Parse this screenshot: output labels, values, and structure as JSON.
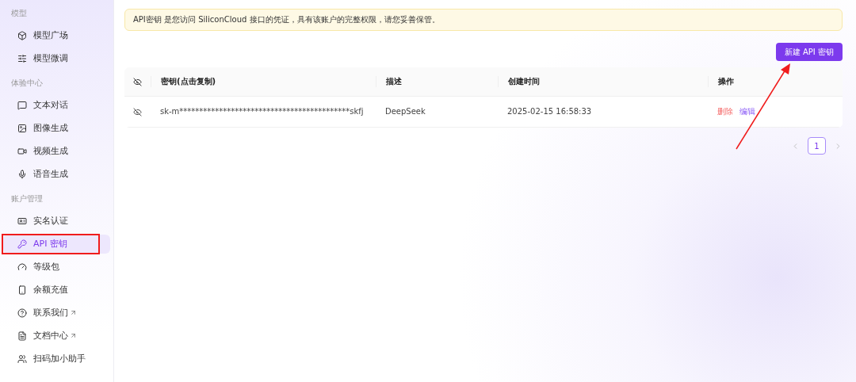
{
  "sidebar": {
    "groups": [
      {
        "heading": "模型",
        "items": [
          {
            "label": "模型广场",
            "selected": false,
            "external": false
          },
          {
            "label": "模型微调",
            "selected": false,
            "external": false
          }
        ]
      },
      {
        "heading": "体验中心",
        "items": [
          {
            "label": "文本对话",
            "selected": false,
            "external": false
          },
          {
            "label": "图像生成",
            "selected": false,
            "external": false
          },
          {
            "label": "视频生成",
            "selected": false,
            "external": false
          },
          {
            "label": "语音生成",
            "selected": false,
            "external": false
          }
        ]
      },
      {
        "heading": "账户管理",
        "items": [
          {
            "label": "实名认证",
            "selected": false,
            "external": false
          },
          {
            "label": "API 密钥",
            "selected": true,
            "external": false,
            "highlighted": true
          },
          {
            "label": "等级包",
            "selected": false,
            "external": false
          },
          {
            "label": "余额充值",
            "selected": false,
            "external": false
          },
          {
            "label": "联系我们",
            "selected": false,
            "external": true
          },
          {
            "label": "文档中心",
            "selected": false,
            "external": true
          },
          {
            "label": "扫码加小助手",
            "selected": false,
            "external": false
          }
        ]
      }
    ]
  },
  "notice": "API密钥 是您访问 SiliconCloud 接口的凭证，具有该账户的完整权限，请您妥善保管。",
  "create_button": "新建 API 密钥",
  "table": {
    "columns": [
      "密钥(点击复制)",
      "描述",
      "创建时间",
      "操作"
    ],
    "rows": [
      {
        "key": "sk-m*******************************************skfj",
        "description": "DeepSeek",
        "created": "2025-02-15 16:58:33",
        "actions": [
          {
            "label": "删除",
            "kind": "danger"
          },
          {
            "label": "编辑",
            "kind": "primary"
          }
        ]
      }
    ]
  },
  "pagination": {
    "pages": [
      {
        "label": "1",
        "selected": true
      }
    ]
  }
}
